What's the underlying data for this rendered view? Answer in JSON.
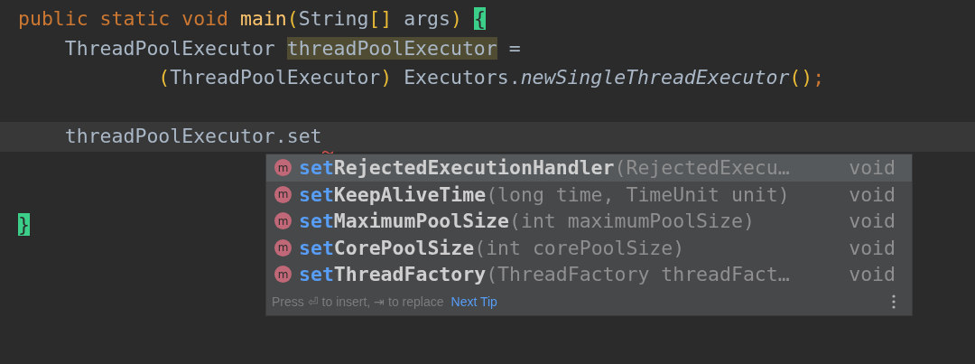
{
  "editor": {
    "lines": [
      {
        "current": false,
        "tokens": [
          {
            "text": "public static void ",
            "kind": "keyword"
          },
          {
            "text": "main",
            "kind": "method"
          },
          {
            "text": "(",
            "kind": "bracket"
          },
          {
            "text": "String",
            "kind": "plain"
          },
          {
            "text": "[]",
            "kind": "bracket"
          },
          {
            "text": " args",
            "kind": "plain"
          },
          {
            "text": ") ",
            "kind": "bracket"
          },
          {
            "text": "{",
            "kind": "brace-match"
          }
        ]
      },
      {
        "current": false,
        "tokens": [
          {
            "text": "    ThreadPoolExecutor ",
            "kind": "plain"
          },
          {
            "text": "threadPoolExecutor",
            "kind": "highlight"
          },
          {
            "text": " =",
            "kind": "plain"
          }
        ]
      },
      {
        "current": false,
        "tokens": [
          {
            "text": "            (",
            "kind": "bracket"
          },
          {
            "text": "ThreadPoolExecutor",
            "kind": "plain"
          },
          {
            "text": ")",
            "kind": "bracket"
          },
          {
            "text": " Executors.",
            "kind": "plain"
          },
          {
            "text": "newSingleThreadExecutor",
            "kind": "static-call"
          },
          {
            "text": "()",
            "kind": "bracket"
          },
          {
            "text": ";",
            "kind": "keyword"
          }
        ]
      },
      {
        "current": false
      },
      {
        "current": true,
        "squiggle": true,
        "tokens": [
          {
            "text": "    threadPoolExecutor.set",
            "kind": "plain"
          }
        ]
      },
      {
        "current": false
      },
      {
        "current": false
      },
      {
        "current": false,
        "tokens": [
          {
            "text": "}",
            "kind": "brace-match"
          }
        ]
      }
    ]
  },
  "completion": {
    "items": [
      {
        "icon": "m",
        "prefix": "set",
        "name": "RejectedExecutionHandler",
        "params": "(RejectedExecu…",
        "return_type": "void",
        "selected": true
      },
      {
        "icon": "m",
        "prefix": "set",
        "name": "KeepAliveTime",
        "params": "(long time, TimeUnit unit)",
        "return_type": "void",
        "selected": false
      },
      {
        "icon": "m",
        "prefix": "set",
        "name": "MaximumPoolSize",
        "params": "(int maximumPoolSize)",
        "return_type": "void",
        "selected": false
      },
      {
        "icon": "m",
        "prefix": "set",
        "name": "CorePoolSize",
        "params": "(int corePoolSize)",
        "return_type": "void",
        "selected": false
      },
      {
        "icon": "m",
        "prefix": "set",
        "name": "ThreadFactory",
        "params": "(ThreadFactory threadFact…",
        "return_type": "void",
        "selected": false
      }
    ],
    "hint": "Press ⏎ to insert, ⇥ to replace",
    "link": "Next Tip"
  }
}
